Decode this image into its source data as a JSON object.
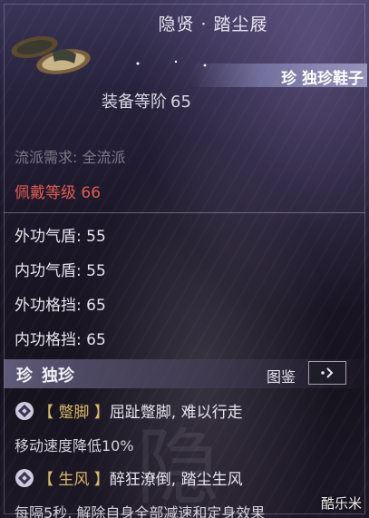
{
  "item": {
    "title": "隐贤 · 踏尘屐",
    "rarity": "珍 独珍鞋子",
    "gear_level_label": "装备等阶",
    "gear_level_value": "65",
    "school_requirement": "流派需求: 全流派",
    "wear_level_label": "佩戴等级",
    "wear_level_value": "66"
  },
  "stats": [
    {
      "label": "外功气盾: 55"
    },
    {
      "label": "内功气盾: 55"
    },
    {
      "label": "外功格挡: 65"
    },
    {
      "label": "内功格挡: 65"
    }
  ],
  "set_section": {
    "badge": "珍",
    "title": "独珍",
    "atlas_label": "图鉴"
  },
  "effects": [
    {
      "tag": "【 蹩脚 】",
      "text": "屈趾蹩脚, 难以行走",
      "desc": "移动速度降低10%"
    },
    {
      "tag": "【 生风 】",
      "text": "醉狂潦倒, 踏尘生风",
      "desc": "每隔5秒, 解除自身全部减速和定身效果"
    }
  ],
  "watermark": "酷乐米",
  "colors": {
    "wear_level": "#e05a52",
    "effect_tag": "#d9b96a",
    "school_text": "#7d7a88"
  },
  "icons": [
    "slippers-icon",
    "diamond-bullet-icon",
    "arrow-right-icon"
  ]
}
